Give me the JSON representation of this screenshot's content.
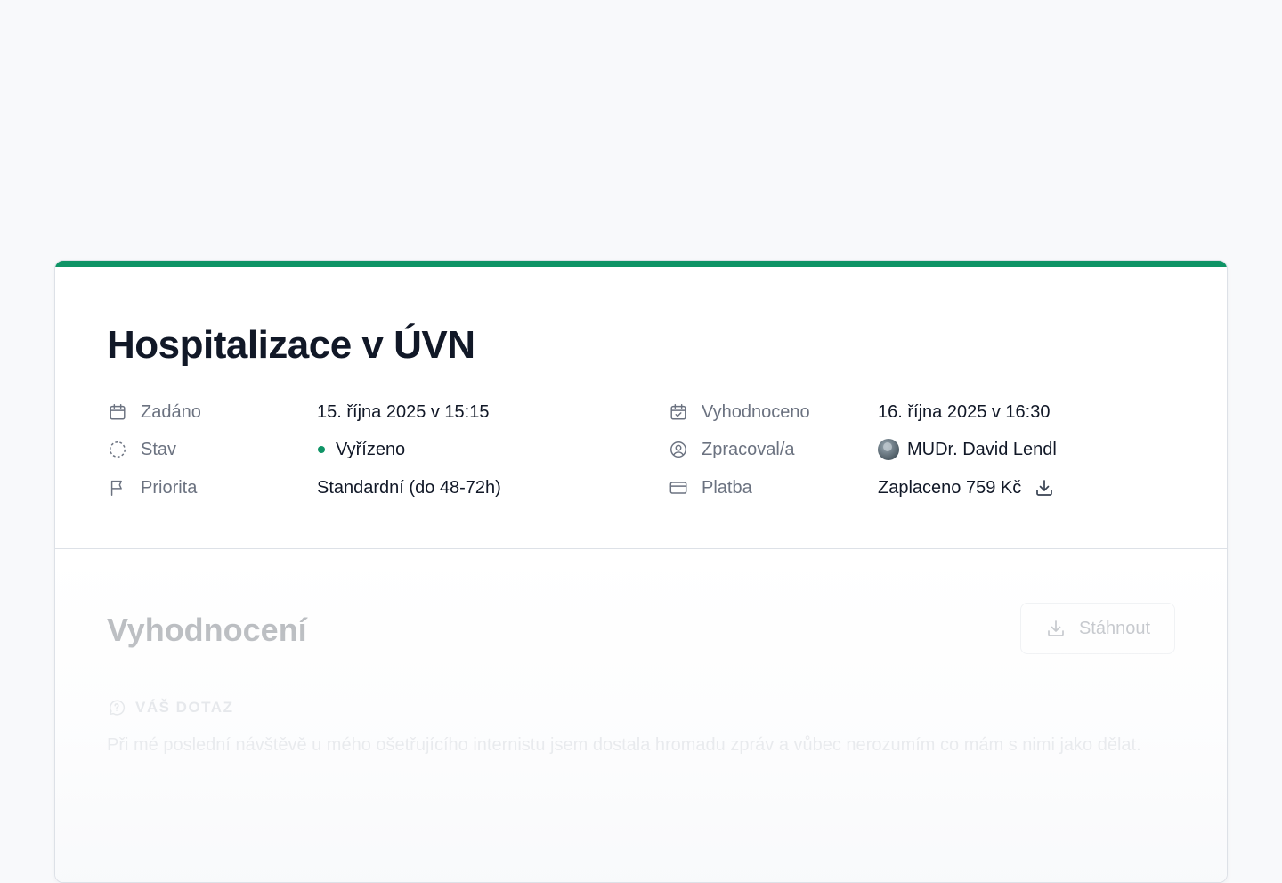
{
  "request": {
    "title": "Hospitalizace v ÚVN",
    "accent_color": "#0f9466"
  },
  "meta_left": [
    {
      "icon": "calendar-icon",
      "label": "Zadáno",
      "value": "15. října 2025 v 15:15"
    },
    {
      "icon": "status-circle-icon",
      "label": "Stav",
      "value": "Vyřízeno",
      "status_color": "#0f9466"
    },
    {
      "icon": "flag-icon",
      "label": "Priorita",
      "value": "Standardní (do 48-72h)"
    }
  ],
  "meta_right": [
    {
      "icon": "calendar-check-icon",
      "label": "Vyhodnoceno",
      "value": "16. října 2025 v 16:30"
    },
    {
      "icon": "user-circle-icon",
      "label": "Zpracoval/a",
      "value": "MUDr. David Lendl"
    },
    {
      "icon": "credit-card-icon",
      "label": "Platba",
      "value": "Zaplaceno 759 Kč",
      "action_icon": "download-icon"
    }
  ],
  "evaluation": {
    "title": "Vyhodnocení",
    "download_label": "Stáhnout",
    "question_label": "VÁŠ DOTAZ",
    "question_text": "Při mé poslední návštěvě u mého ošetřujícího internistu jsem dostala hromadu zpráv a vůbec nerozumím co mám s nimi jako dělat."
  }
}
